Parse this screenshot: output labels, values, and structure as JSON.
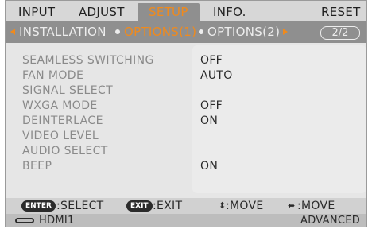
{
  "tabs": [
    {
      "label": "INPUT",
      "active": false
    },
    {
      "label": "ADJUST",
      "active": false
    },
    {
      "label": "SETUP",
      "active": true
    },
    {
      "label": "INFO.",
      "active": false
    },
    {
      "label": "RESET",
      "active": false
    }
  ],
  "subtabs": [
    {
      "label": "INSTALLATION",
      "active": false
    },
    {
      "label": "OPTIONS(1)",
      "active": true
    },
    {
      "label": "OPTIONS(2)",
      "active": false
    }
  ],
  "page_indicator": "2/2",
  "settings": [
    {
      "label": "SEAMLESS SWITCHING",
      "value": "OFF"
    },
    {
      "label": "FAN MODE",
      "value": "AUTO"
    },
    {
      "label": "SIGNAL SELECT",
      "value": ""
    },
    {
      "label": "WXGA MODE",
      "value": "OFF"
    },
    {
      "label": "DEINTERLACE",
      "value": "ON"
    },
    {
      "label": "VIDEO LEVEL",
      "value": ""
    },
    {
      "label": "AUDIO SELECT",
      "value": ""
    },
    {
      "label": "BEEP",
      "value": "ON"
    }
  ],
  "hints": {
    "enter_key": "ENTER",
    "enter_text": ":SELECT",
    "exit_key": "EXIT",
    "exit_text": ":EXIT",
    "move_vertical_glyph": "⬍",
    "move_vertical_text": ":MOVE",
    "move_horizontal_glyph": "⬌",
    "move_horizontal_text": ":MOVE"
  },
  "status": {
    "input_icon": "hdmi-port-icon",
    "input_name": "HDMI1",
    "menu_mode": "ADVANCED"
  },
  "colors": {
    "accent": "#f08a1c",
    "subbar": "#8f8f8f",
    "panel": "#e6e6e6"
  }
}
